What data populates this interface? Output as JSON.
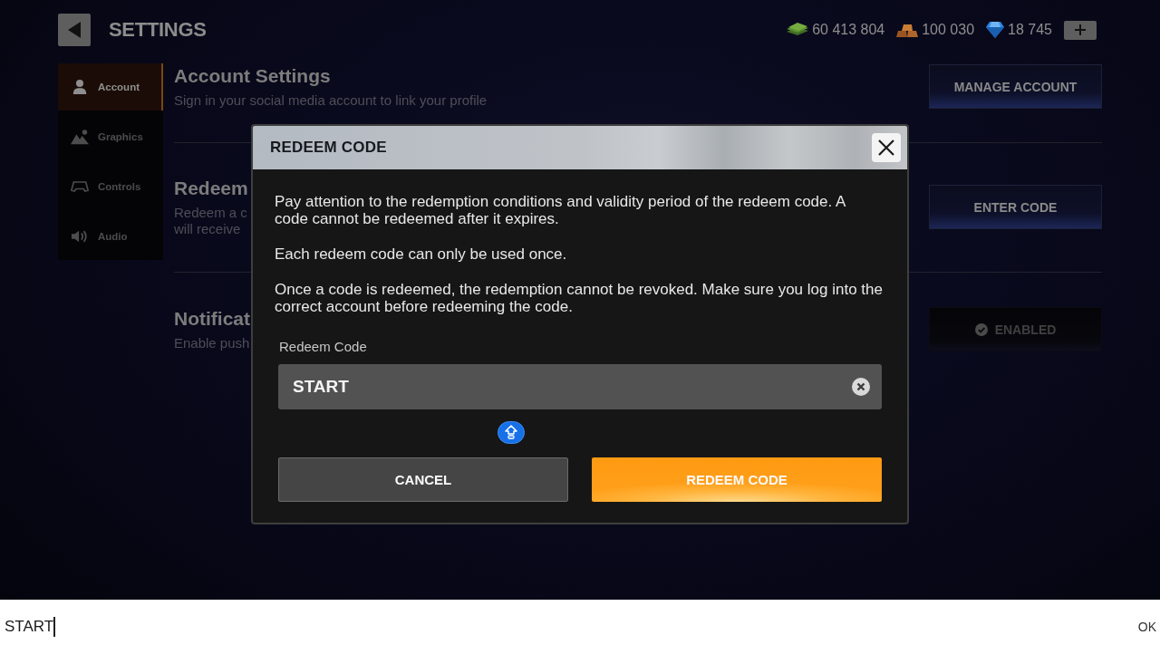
{
  "header": {
    "title": "SETTINGS",
    "currencies": [
      {
        "amount": "60 413 804"
      },
      {
        "amount": "100 030"
      },
      {
        "amount": "18 745"
      }
    ]
  },
  "sidebar": {
    "items": [
      {
        "label": "Account",
        "selected": true
      },
      {
        "label": "Graphics",
        "selected": false
      },
      {
        "label": "Controls",
        "selected": false
      },
      {
        "label": "Audio",
        "selected": false
      }
    ]
  },
  "sections": [
    {
      "title": "Account Settings",
      "description": [
        "Sign in your social media account to link your profile"
      ],
      "button": {
        "kind": "action",
        "label": "MANAGE ACCOUNT"
      }
    },
    {
      "title": "Redeem",
      "description": [
        "Redeem a c",
        "will receive"
      ],
      "button": {
        "kind": "action",
        "label": "ENTER CODE"
      }
    },
    {
      "title": "Notificat",
      "description": [
        "Enable push"
      ],
      "button": {
        "kind": "toggle",
        "label": "ENABLED",
        "on": true
      }
    }
  ],
  "dialog": {
    "title": "REDEEM CODE",
    "paragraphs": [
      "Pay attention to the redemption conditions and validity period of the redeem code. A code cannot be redeemed after it expires.",
      "Each redeem code can only be used once.",
      "Once a code is redeemed, the redemption cannot be revoked. Make sure you log into the correct account before redeeming the code."
    ],
    "field": {
      "label": "Redeem Code",
      "value": "START"
    },
    "buttons": [
      {
        "kind": "secondary",
        "label": "CANCEL"
      },
      {
        "kind": "primary",
        "label": "REDEEM CODE"
      }
    ]
  },
  "input_bar": {
    "value": "START",
    "action": "OK"
  }
}
